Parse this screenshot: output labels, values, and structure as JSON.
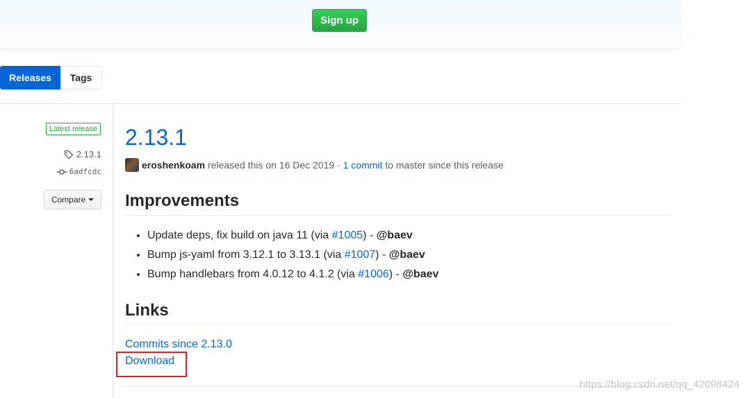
{
  "banner": {
    "signup_label": "Sign up",
    "signup_color": "#28a745"
  },
  "tabs": [
    {
      "label": "Releases",
      "active": true
    },
    {
      "label": "Tags",
      "active": false
    }
  ],
  "meta": {
    "latest_badge": "Latest release",
    "tag_icon": "tag-icon",
    "tag": "2.13.1",
    "commit_icon": "git-commit-icon",
    "commit": "6adfcdc",
    "compare_label": "Compare"
  },
  "release": {
    "title": "2.13.1",
    "author": "eroshenkoam",
    "released_text": "released this on 16 Dec 2019 ·",
    "commit_link": "1 commit",
    "since_text": "to master since this release"
  },
  "improvements": {
    "heading": "Improvements",
    "items": [
      {
        "text": "Update deps, fix build on java 11 (via ",
        "link": "#1005",
        "after": ") - ",
        "user": "@baev"
      },
      {
        "text": "Bump js-yaml from 3.12.1 to 3.13.1 (via ",
        "link": "#1007",
        "after": ") - ",
        "user": "@baev"
      },
      {
        "text": "Bump handlebars from 4.0.12 to 4.1.2 (via ",
        "link": "#1006",
        "after": ") - ",
        "user": "@baev"
      }
    ]
  },
  "links": {
    "heading": "Links",
    "commits_since": "Commits since 2.13.0",
    "download": "Download"
  },
  "watermark": "https://blog.csdn.net/qq_42098424",
  "colors": {
    "link": "#0366d6",
    "primary": "#0366d6",
    "success": "#28a745",
    "highlight": "#e02020"
  }
}
